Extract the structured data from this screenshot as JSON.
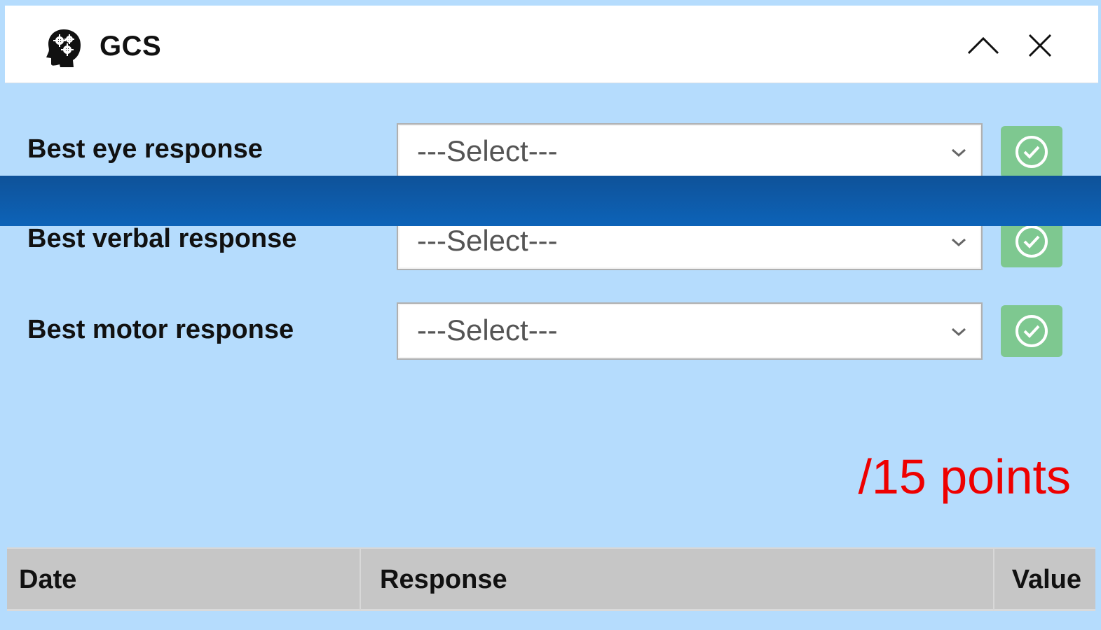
{
  "header": {
    "title": "GCS",
    "icon": "head-gears-icon",
    "collapse_icon": "chevron-up-icon",
    "close_icon": "close-icon"
  },
  "form": {
    "rows": [
      {
        "label": "Best eye response",
        "select_value": "---Select---"
      },
      {
        "label": "Best verbal response",
        "select_value": "---Select---"
      },
      {
        "label": "Best motor response",
        "select_value": "---Select---"
      }
    ],
    "confirm_icon": "check-circle-icon"
  },
  "total": {
    "text": "/15 points",
    "color": "#ee0000"
  },
  "table": {
    "columns": [
      "Date",
      "Response",
      "Value"
    ]
  },
  "colors": {
    "background": "#b5dcfd",
    "confirm_button": "#7ec890",
    "banner": "#0d5ba8",
    "table_header": "#c6c6c6"
  }
}
